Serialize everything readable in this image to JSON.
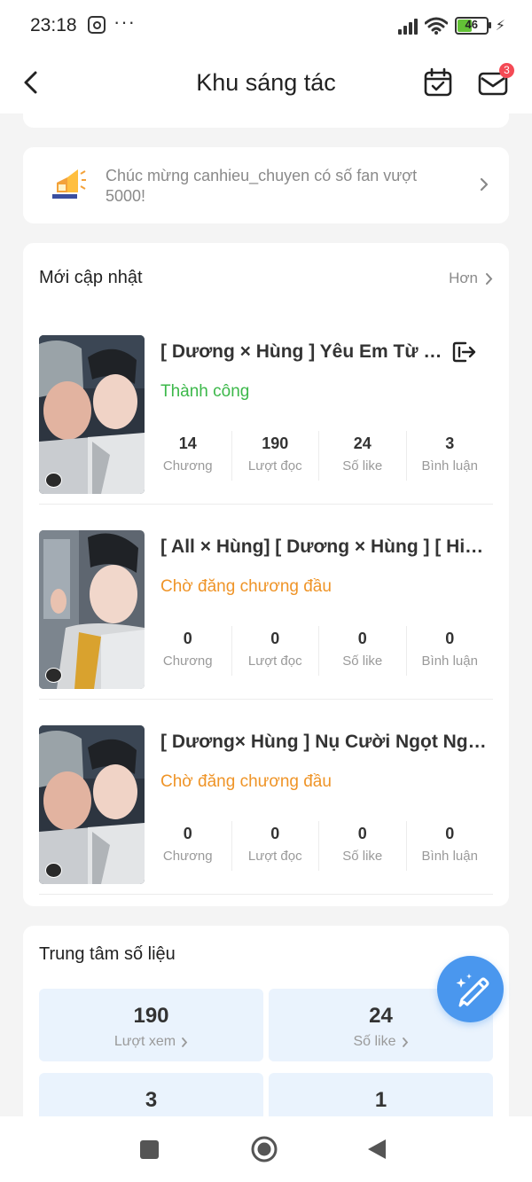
{
  "status_bar": {
    "time": "23:18",
    "more": "···",
    "battery": "46"
  },
  "header": {
    "title": "Khu sáng tác",
    "mail_badge": "3"
  },
  "notice": {
    "text": "Chúc mừng canhieu_chuyen có số fan vượt 5000!"
  },
  "updates": {
    "title": "Mới cập nhật",
    "more": "Hơn",
    "items": [
      {
        "title": "[ Dương × Hùng ] Yêu Em Từ Cái Nhìn Đầu Tiên",
        "status": "Thành công",
        "stats": [
          {
            "value": "14",
            "label": "Chương"
          },
          {
            "value": "190",
            "label": "Lượt đọc"
          },
          {
            "value": "24",
            "label": "Số like"
          },
          {
            "value": "3",
            "label": "Bình luận"
          }
        ]
      },
      {
        "title": "[ All × Hùng] [ Dương × Hùng ] [ Hiếu × Hùng ]",
        "status": "Chờ đăng chương đầu",
        "stats": [
          {
            "value": "0",
            "label": "Chương"
          },
          {
            "value": "0",
            "label": "Lượt đọc"
          },
          {
            "value": "0",
            "label": "Số like"
          },
          {
            "value": "0",
            "label": "Bình luận"
          }
        ]
      },
      {
        "title": "[ Dương× Hùng ] Nụ Cười Ngọt Ngào",
        "status": "Chờ đăng chương đầu",
        "stats": [
          {
            "value": "0",
            "label": "Chương"
          },
          {
            "value": "0",
            "label": "Lượt đọc"
          },
          {
            "value": "0",
            "label": "Số like"
          },
          {
            "value": "0",
            "label": "Bình luận"
          }
        ]
      }
    ]
  },
  "metrics": {
    "title": "Trung tâm số liệu",
    "tiles": [
      {
        "value": "190",
        "label": "Lượt xem"
      },
      {
        "value": "24",
        "label": "Số like"
      },
      {
        "value": "3",
        "label": ""
      },
      {
        "value": "1",
        "label": ""
      }
    ]
  },
  "colors": {
    "success": "#3cb84a",
    "pending": "#ef9427",
    "accent": "#4a97ee",
    "badge": "#f44a55"
  }
}
